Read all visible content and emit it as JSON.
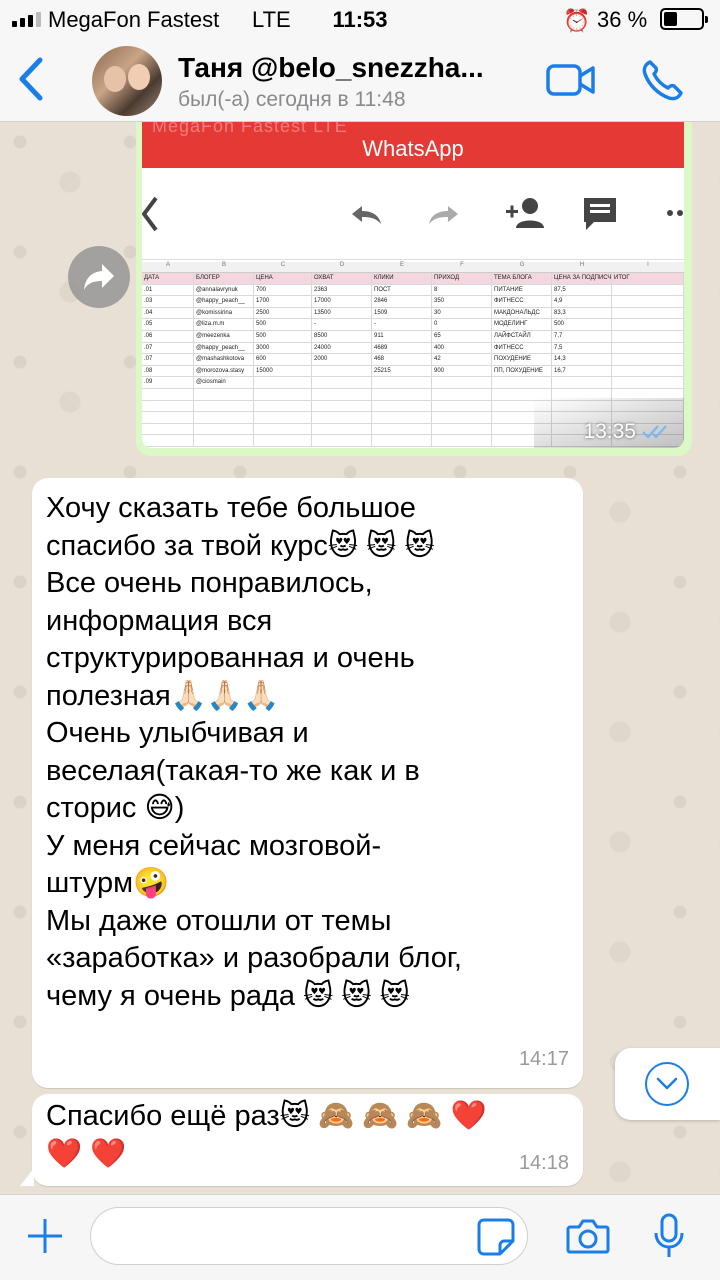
{
  "status_bar": {
    "carrier": "MegaFon Fastest",
    "network": "LTE",
    "time": "11:53",
    "battery_percent": "36 %",
    "battery_level": 0.36,
    "signal_bars": 3
  },
  "header": {
    "contact_name": "Таня @belo_snezzha...",
    "last_seen": "был(-а) сегодня в 11:48",
    "icons": [
      "back-icon",
      "video-call-icon",
      "phone-icon"
    ]
  },
  "image_message": {
    "time": "13:35",
    "status_icon": "double-check-icon",
    "screenshot": {
      "app_title": "WhatsApp",
      "faint_status_text": "MegaFon Fastest  LTE",
      "column_letters": [
        "A",
        "B",
        "C",
        "D",
        "E",
        "F",
        "G",
        "H",
        "I"
      ],
      "headers": [
        "ДАТА",
        "БЛОГЕР",
        "ЦЕНА",
        "ОХВАТ",
        "КЛИКИ",
        "ПРИХОД",
        "ТЕМА БЛОГА",
        "ЦЕНА ЗА ПОДПИСЧ",
        "ИТОГ"
      ],
      "rows": [
        [
          ".01",
          "@annalavrynuk",
          "700",
          "2363",
          "ПОСТ",
          "8",
          "ПИТАНИЕ",
          "87,5",
          ""
        ],
        [
          ".03",
          "@happy_peach__",
          "1700",
          "17000",
          "2846",
          "350",
          "ФИТНЕСС",
          "4,9",
          ""
        ],
        [
          ".04",
          "@komissirina",
          "2500",
          "13500",
          "1509",
          "30",
          "МАКДОНАЛЬДС",
          "83,3",
          ""
        ],
        [
          ".05",
          "@liza.m.m",
          "500",
          "-",
          "-",
          "0",
          "МОДЕЛИНГ",
          "500",
          ""
        ],
        [
          ".06",
          "@meezenka",
          "500",
          "8500",
          "911",
          "65",
          "ЛАЙФСТАЙЛ",
          "7,7",
          ""
        ],
        [
          ".07",
          "@happy_peach__",
          "3000",
          "24000",
          "4689",
          "400",
          "ФИТНЕСС",
          "7,5",
          ""
        ],
        [
          ".07",
          "@mashashkotova",
          "600",
          "2000",
          "468",
          "42",
          "ПОХУДЕНИЕ",
          "14,3",
          ""
        ],
        [
          ".08",
          "@morozova.stasy",
          "15000",
          "",
          "25215",
          "900",
          "ПП, ПОХУДЕНИЕ",
          "16,7",
          ""
        ],
        [
          ".09",
          "@ciosmain",
          "",
          "",
          "",
          "",
          "",
          "",
          ""
        ],
        [
          "",
          "",
          "",
          "",
          "",
          "",
          "",
          "",
          ""
        ],
        [
          "",
          "",
          "",
          "",
          "",
          "",
          "",
          "",
          ""
        ],
        [
          "",
          "",
          "",
          "",
          "",
          "",
          "",
          "",
          ""
        ],
        [
          "",
          "",
          "",
          "",
          "",
          "",
          "",
          "",
          ""
        ],
        [
          "",
          "",
          "",
          "",
          "",
          "",
          "",
          "",
          ""
        ]
      ]
    }
  },
  "messages": [
    {
      "lines": [
        "Хочу сказать тебе большое",
        "спасибо за твой курс😻 😻 😻",
        "Все очень понравилось,",
        "информация вся",
        "структурированная и очень",
        "полезная🙏🏻🙏🏻🙏🏻",
        "Очень улыбчивая и",
        "веселая(такая-то же как и в",
        "сторис 😅)",
        "У меня сейчас мозговой-",
        "штурм🤪",
        "Мы даже отошли от темы",
        "«заработка» и разобрали блог,",
        "чему я очень рада 😻 😻 😻"
      ],
      "time": "14:17"
    },
    {
      "lines": [
        "Спасибо ещё раз😻 🙈 🙈 🙈 ❤️",
        "❤️ ❤️"
      ],
      "time": "14:18"
    }
  ],
  "input": {
    "value": "",
    "placeholder": ""
  },
  "colors": {
    "accent": "#1a7ee8",
    "outgoing_bubble": "#dcf8c6",
    "incoming_bubble": "#ffffff",
    "chat_background": "#e9e1d6",
    "screenshot_header": "#e53935"
  }
}
